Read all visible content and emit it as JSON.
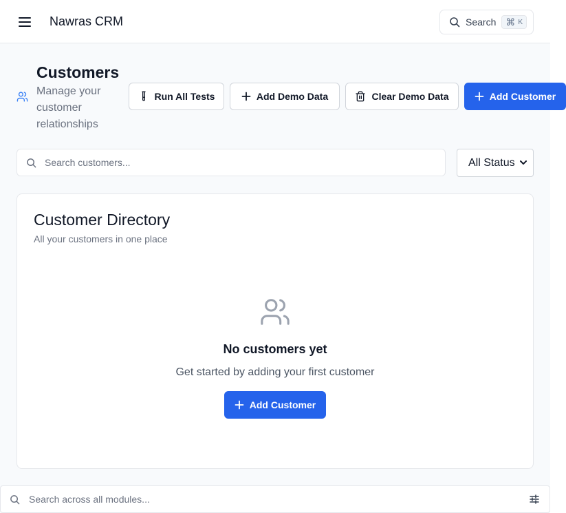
{
  "header": {
    "app_title": "Nawras CRM",
    "search_label": "Search",
    "search_shortcut_symbol": "⌘",
    "search_shortcut_key": "K"
  },
  "page": {
    "title": "Customers",
    "subtitle": "Manage your customer relationships",
    "icon": "users-icon"
  },
  "actions": {
    "run_tests": "Run All Tests",
    "add_demo": "Add Demo Data",
    "clear_demo": "Clear Demo Data",
    "add_customer": "Add Customer"
  },
  "filters": {
    "search_placeholder": "Search customers...",
    "status_selected": "All Status"
  },
  "directory": {
    "title": "Customer Directory",
    "description": "All your customers in one place",
    "empty_title": "No customers yet",
    "empty_description": "Get started by adding your first customer",
    "empty_button": "Add Customer"
  },
  "global_search": {
    "placeholder": "Search across all modules..."
  },
  "colors": {
    "primary": "#2563eb",
    "accent_icon": "#3b82f6",
    "muted_icon": "#9ca3af"
  }
}
